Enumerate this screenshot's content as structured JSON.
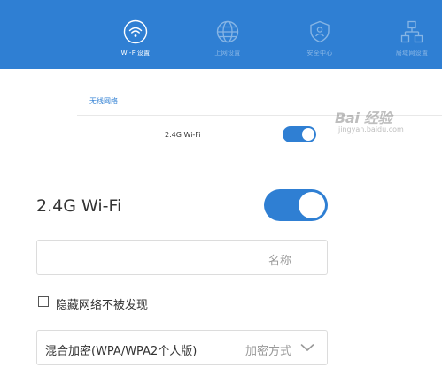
{
  "header": {
    "tabs": [
      {
        "label": "Wi-Fi设置",
        "icon": "wifi-icon",
        "active": true
      },
      {
        "label": "上网设置",
        "icon": "globe-icon",
        "active": false
      },
      {
        "label": "安全中心",
        "icon": "shield-icon",
        "active": false
      },
      {
        "label": "局域网设置",
        "icon": "network-icon",
        "active": false
      }
    ],
    "bg_color": "#2f7fd3"
  },
  "section": {
    "title": "无线网络",
    "row_label": "2.4G Wi-Fi",
    "row_toggle_on": true
  },
  "wifi": {
    "label": "2.4G Wi-Fi",
    "toggle_on": true,
    "name_value": "",
    "name_label": "名称",
    "hide_network_label": "隐藏网络不被发现",
    "hide_network_checked": false,
    "encryption_value": "混合加密(WPA/WPA2个人版)",
    "encryption_label": "加密方式"
  },
  "watermark": {
    "main": "Bai 经验",
    "sub": "jingyan.baidu.com"
  },
  "accent_color": "#2f7fd3"
}
